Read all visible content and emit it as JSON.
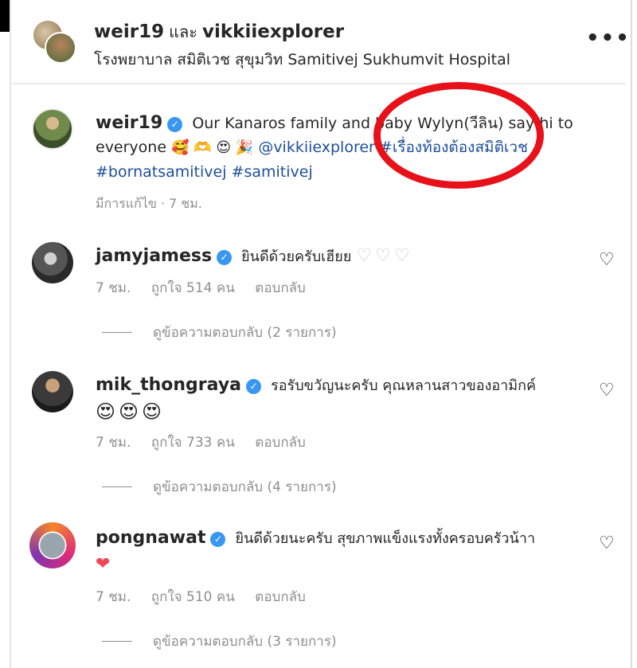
{
  "header": {
    "user1": "weir19",
    "connector": "และ",
    "user2": "vikkiiexplorer",
    "location": "โรงพยาบาล สมิติเวช สุขุมวิท Samitivej Sukhumvit Hospital",
    "more": "•••"
  },
  "caption": {
    "username": "weir19",
    "verified": "✓",
    "text_part1": "Our Kanaros family and baby Wylyn(วีลิน) say hi to everyone",
    "emojis": "🥰 🫶 😍 🎉",
    "mention": "@vikkiiexplorer",
    "hashtag1": "#เรื่องท้องต้องสมิติเวช",
    "hashtag2": "#bornatsamitivej",
    "hashtag3": "#samitivej",
    "edited_meta": "มีการแก้ไข · 7 ชม."
  },
  "comments": [
    {
      "username": "jamyjamess",
      "text": "ยินดีด้วยครับเฮียย",
      "trail": "♡♡♡",
      "time": "7 ชม.",
      "likes": "ถูกใจ 514 คน",
      "reply": "ตอบกลับ",
      "view_replies": "ดูข้อความตอบกลับ (2 รายการ)"
    },
    {
      "username": "mik_thongraya",
      "text": "รอรับขวัญนะครับ คุณหลานสาวของอามิกค์",
      "trail": "😍😍😍",
      "time": "7 ชม.",
      "likes": "ถูกใจ 733 คน",
      "reply": "ตอบกลับ",
      "view_replies": "ดูข้อความตอบกลับ (4 รายการ)"
    },
    {
      "username": "pongnawat",
      "text": "ยินดีด้วยนะครับ สุขภาพแข็งแรงทั้งครอบครัวน้าา",
      "trail": "❤",
      "time": "7 ชม.",
      "likes": "ถูกใจ 510 คน",
      "reply": "ตอบกลับ",
      "view_replies": "ดูข้อความตอบกลับ (3 รายการ)"
    }
  ],
  "icons": {
    "heart_outline": "♡",
    "verified_color": "#3897f0",
    "annotation_circle_color": "#e8111a",
    "hashtag_color": "#1e4e9c"
  }
}
